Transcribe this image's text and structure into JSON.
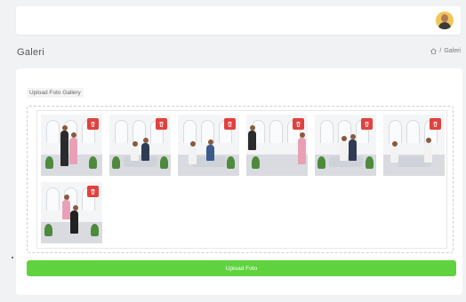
{
  "header": {
    "avatar_icon": "user-avatar"
  },
  "page": {
    "title": "Galeri"
  },
  "breadcrumb": {
    "home_icon": "home-icon",
    "separator": "/",
    "current": "Galeri"
  },
  "gallery": {
    "label": "Upload Foto Gallery",
    "delete_icon": "trash-icon",
    "delete_color": "#e2423f",
    "photos": [
      {
        "alt": "photo-1"
      },
      {
        "alt": "photo-2"
      },
      {
        "alt": "photo-3"
      },
      {
        "alt": "photo-4"
      },
      {
        "alt": "photo-5"
      },
      {
        "alt": "photo-6"
      },
      {
        "alt": "photo-7"
      }
    ]
  },
  "upload_button": {
    "label": "Upload Foto",
    "color": "#5fd33f"
  }
}
